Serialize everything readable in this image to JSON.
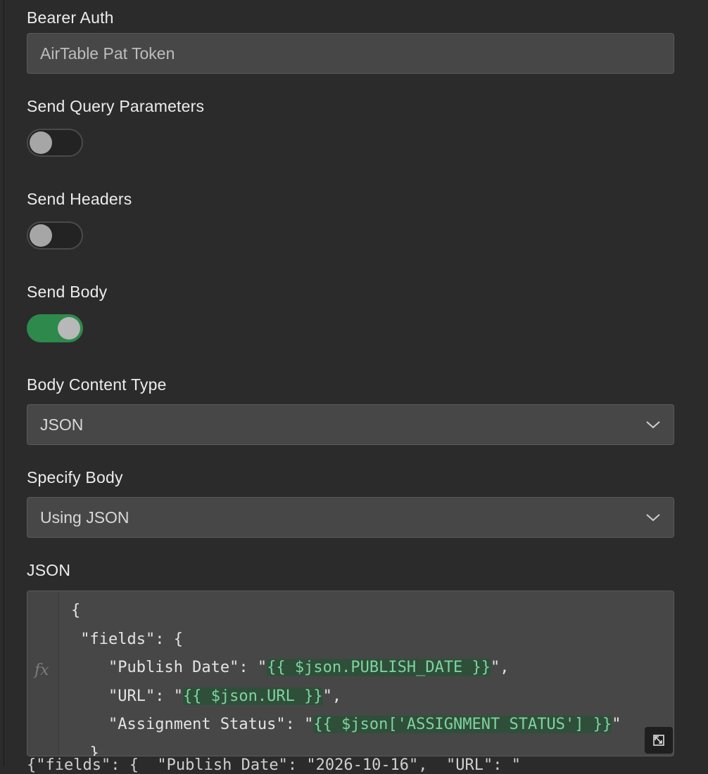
{
  "bearer_auth": {
    "label": "Bearer Auth",
    "value": "AirTable Pat Token"
  },
  "send_query_parameters": {
    "label": "Send Query Parameters",
    "enabled": false
  },
  "send_headers": {
    "label": "Send Headers",
    "enabled": false
  },
  "send_body": {
    "label": "Send Body",
    "enabled": true
  },
  "body_content_type": {
    "label": "Body Content Type",
    "selected": "JSON"
  },
  "specify_body": {
    "label": "Specify Body",
    "selected": "Using JSON"
  },
  "json_editor": {
    "label": "JSON",
    "gutter_label": "fx",
    "lines": [
      {
        "parts": [
          {
            "text": "{"
          }
        ]
      },
      {
        "parts": [
          {
            "text": " \"fields\": {"
          }
        ]
      },
      {
        "parts": [
          {
            "text": "    \"Publish Date\": \""
          },
          {
            "text": "{{ $json.PUBLISH_DATE }}",
            "expr": true
          },
          {
            "text": "\","
          }
        ]
      },
      {
        "parts": [
          {
            "text": "    \"URL\": \""
          },
          {
            "text": "{{ $json.URL }}",
            "expr": true
          },
          {
            "text": "\","
          }
        ]
      },
      {
        "parts": [
          {
            "text": "    \"Assignment Status\": \""
          },
          {
            "text": "{{ $json['ASSIGNMENT STATUS'] }}",
            "expr": true
          },
          {
            "text": "\""
          }
        ]
      },
      {
        "parts": [
          {
            "text": "  }"
          }
        ]
      }
    ],
    "preview_line": "{\"fields\": {  \"Publish Date\": \"2026-10-16\",  \"URL\": \""
  },
  "colors": {
    "toggle_on": "#2d8a4c",
    "expression_bg": "#2f4f3a",
    "expression_text": "#7fd3a0"
  },
  "icons": {
    "dropdown": "chevron-down-icon",
    "expand": "expand-icon"
  }
}
